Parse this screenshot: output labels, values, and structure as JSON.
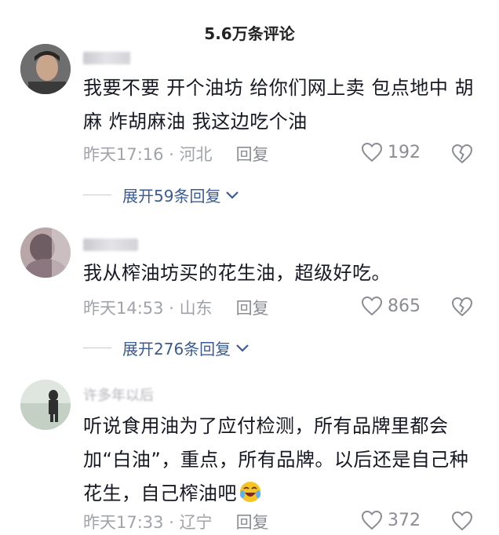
{
  "header": {
    "title": "5.6万条评论"
  },
  "comments": [
    {
      "username": "大…",
      "text": "我要不要 开个油坊 给你们网上卖 包点地中 胡麻 炸胡麻油 我这边吃个油",
      "time": "昨天17:16",
      "location": "河北",
      "reply_label": "回复",
      "likes": "192",
      "expand_label": "展开59条回复"
    },
    {
      "username": "",
      "text": "我从榨油坊买的花生油，超级好吃。",
      "time": "昨天14:53",
      "location": "山东",
      "reply_label": "回复",
      "likes": "865",
      "expand_label": "展开276条回复"
    },
    {
      "username": "许多年以后",
      "text": "听说食用油为了应付检测，所有品牌里都会加“白油”，重点，所有品牌。以后还是自己种花生，自己榨油吧",
      "time": "昨天17:33",
      "location": "辽宁",
      "reply_label": "回复",
      "likes": "372"
    }
  ],
  "separator": " · ",
  "icons": {
    "like": "heart-outline-icon",
    "dislike": "broken-heart-icon",
    "expand": "chevron-down-icon",
    "emoji": "laughing-tears-emoji-icon"
  },
  "colors": {
    "link": "#3b5b92",
    "meta": "#a1a3ab",
    "text": "#161823"
  }
}
